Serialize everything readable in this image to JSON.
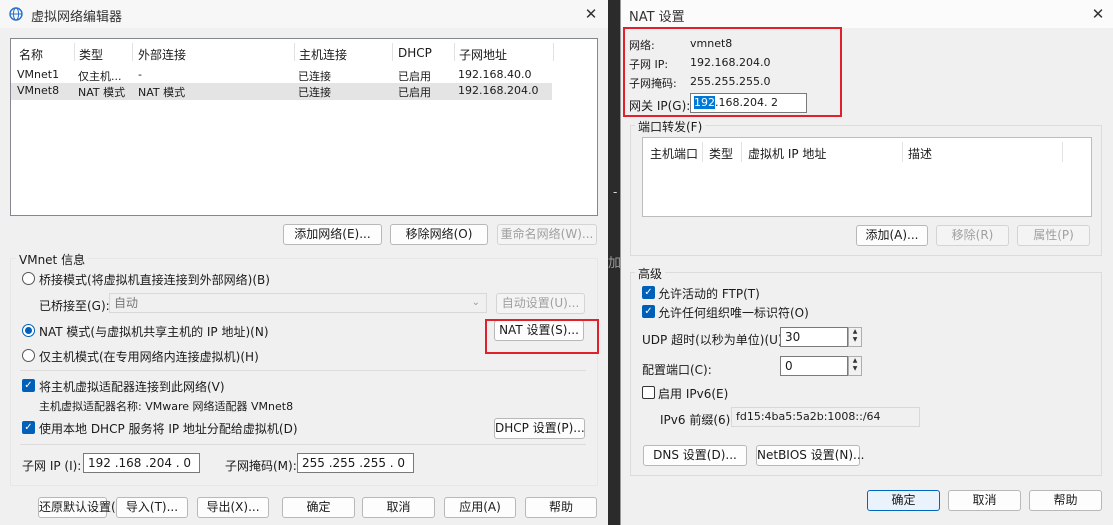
{
  "vne": {
    "title": "虚拟网络编辑器",
    "columns": [
      "名称",
      "类型",
      "外部连接",
      "主机连接",
      "DHCP",
      "子网地址"
    ],
    "rows": [
      [
        "VMnet1",
        "仅主机...",
        "-",
        "已连接",
        "已启用",
        "192.168.40.0"
      ],
      [
        "VMnet8",
        "NAT 模式",
        "NAT 模式",
        "已连接",
        "已启用",
        "192.168.204.0"
      ]
    ],
    "buttons": {
      "add": "添加网络(E)...",
      "remove": "移除网络(O)",
      "rename": "重命名网络(W)..."
    },
    "vmnet_info": "VMnet 信息",
    "bridge_mode": "桥接模式(将虚拟机直接连接到外部网络)(B)",
    "bridged_to_label": "已桥接至(G):",
    "bridged_to_value": "自动",
    "auto_settings": "自动设置(U)...",
    "nat_mode": "NAT 模式(与虚拟机共享主机的 IP 地址)(N)",
    "nat_settings": "NAT 设置(S)...",
    "host_only_mode": "仅主机模式(在专用网络内连接虚拟机)(H)",
    "connect_adapter": "将主机虚拟适配器连接到此网络(V)",
    "adapter_name": "主机虚拟适配器名称: VMware 网络适配器 VMnet8",
    "use_dhcp": "使用本地 DHCP 服务将 IP 地址分配给虚拟机(D)",
    "dhcp_settings": "DHCP 设置(P)...",
    "subnet_ip_label": "子网 IP (I):",
    "subnet_ip_value": "192 .168 .204 .  0",
    "subnet_mask_label": "子网掩码(M):",
    "subnet_mask_value": "255 .255 .255 .  0",
    "bottom": {
      "restore": "还原默认设置(R)",
      "import": "导入(T)...",
      "export": "导出(X)...",
      "ok": "确定",
      "cancel": "取消",
      "apply": "应用(A)",
      "help": "帮助"
    }
  },
  "nat": {
    "title": "NAT 设置",
    "network_label": "网络:",
    "network_value": "vmnet8",
    "subnet_ip_label": "子网 IP:",
    "subnet_ip_value": "192.168.204.0",
    "subnet_mask_label": "子网掩码:",
    "subnet_mask_value": "255.255.255.0",
    "gateway_label": "网关 IP(G):",
    "gateway_octets": [
      "192",
      ".168",
      ".204",
      ".  2"
    ],
    "port_forwarding": "端口转发(F)",
    "pf_columns": [
      "主机端口",
      "类型",
      "虚拟机 IP 地址",
      "描述"
    ],
    "pf_buttons": {
      "add": "添加(A)...",
      "remove": "移除(R)",
      "props": "属性(P)"
    },
    "advanced": "高级",
    "allow_ftp": "允许活动的 FTP(T)",
    "allow_any_oui": "允许任何组织唯一标识符(O)",
    "udp_timeout_label": "UDP 超时(以秒为单位)(U):",
    "udp_timeout_value": "30",
    "config_port_label": "配置端口(C):",
    "config_port_value": "0",
    "enable_ipv6": "启用 IPv6(E)",
    "ipv6_prefix_label": "IPv6 前缀(6):",
    "ipv6_prefix_value": "fd15:4ba5:5a2b:1008::/64",
    "dns_settings": "DNS 设置(D)...",
    "netbios_settings": "NetBIOS 设置(N)...",
    "ok": "确定",
    "cancel": "取消",
    "help": "帮助"
  },
  "background": {
    "text_top": "-",
    "text_mid": "加"
  },
  "colors": {
    "highlight_red": "#e0202a",
    "accent_blue": "#005fb8",
    "selection": "#0078d7"
  }
}
